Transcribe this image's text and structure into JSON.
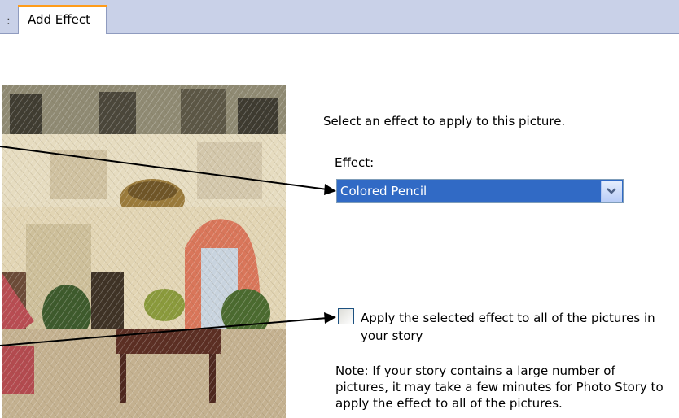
{
  "tabs": {
    "fragment": ":",
    "active": "Add Effect"
  },
  "main": {
    "prompt": "Select an effect to apply to this picture.",
    "effect_label": "Effect:",
    "effect_value": "Colored Pencil",
    "apply_all_label": "Apply the selected effect to all of the pictures in your story",
    "apply_all_checked": false,
    "note": "Note: If your story contains a large number of pictures, it may take a few minutes for Photo Story to apply the effect to all of the pictures."
  },
  "colors": {
    "selection": "#316ac5",
    "tab_accent": "#ff9c1a",
    "tabbar": "#c9d1e8"
  }
}
